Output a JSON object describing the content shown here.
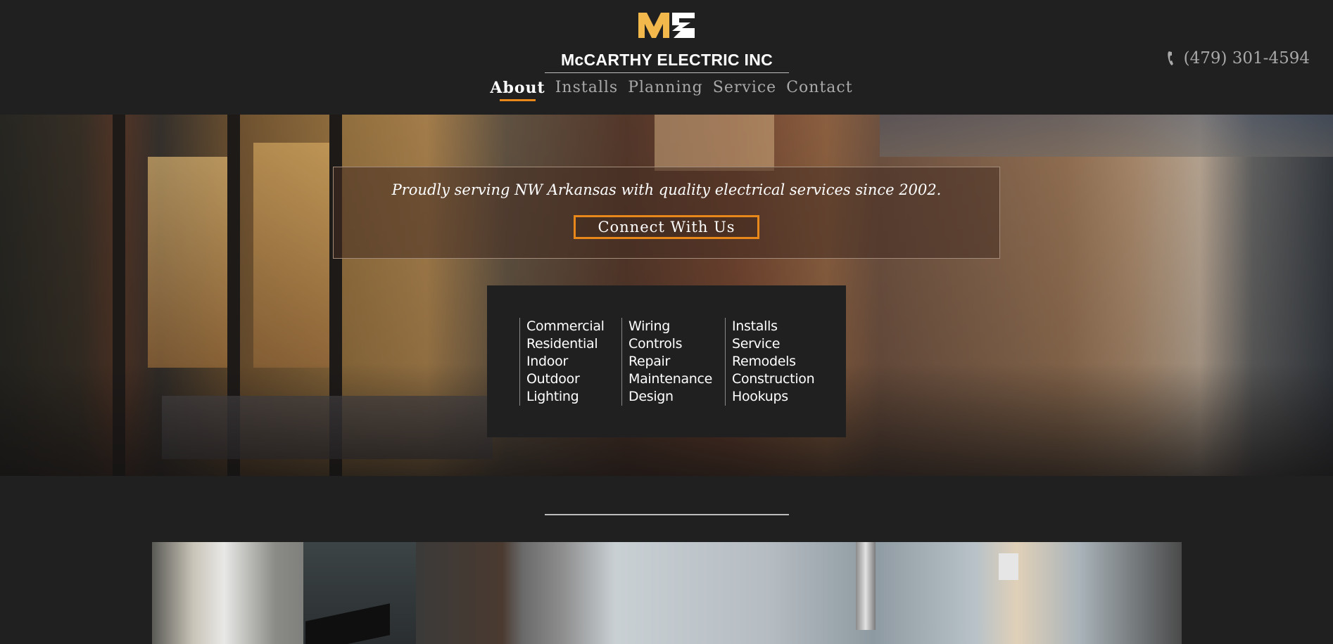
{
  "header": {
    "logo_alt": "ME",
    "brand": "McCARTHY ELECTRIC INC",
    "nav": [
      {
        "label": "About",
        "active": true
      },
      {
        "label": "Installs",
        "active": false
      },
      {
        "label": "Planning",
        "active": false
      },
      {
        "label": "Service",
        "active": false
      },
      {
        "label": "Contact",
        "active": false
      }
    ],
    "phone": "(479) 301-4594"
  },
  "hero": {
    "tagline": "Proudly serving NW Arkansas with quality electrical services since 2002.",
    "cta_label": "Connect With Us"
  },
  "services": {
    "columns": [
      [
        "Commercial",
        "Residential",
        "Indoor",
        "Outdoor",
        "Lighting"
      ],
      [
        "Wiring",
        "Controls",
        "Repair",
        "Maintenance",
        "Design"
      ],
      [
        "Installs",
        "Service",
        "Remodels",
        "Construction",
        "Hookups"
      ]
    ]
  },
  "colors": {
    "background": "#202020",
    "accent": "#e8871a",
    "logo_gold": "#f2b84b",
    "nav_inactive": "#a9a9a9"
  },
  "icons": {
    "phone": "phone-icon",
    "logo": "me-logo-icon"
  }
}
